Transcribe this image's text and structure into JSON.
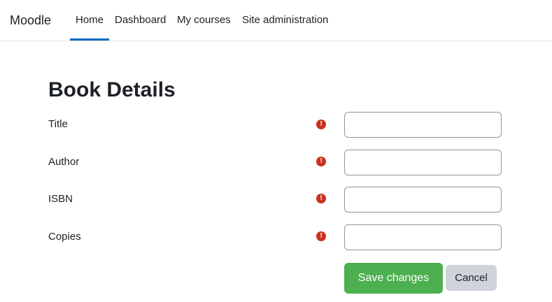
{
  "navbar": {
    "brand": "Moodle",
    "items": [
      {
        "label": "Home",
        "active": true
      },
      {
        "label": "Dashboard",
        "active": false
      },
      {
        "label": "My courses",
        "active": false
      },
      {
        "label": "Site administration",
        "active": false
      }
    ],
    "active_color": "#0f6cbf"
  },
  "main": {
    "title": "Book Details",
    "fields": [
      {
        "label": "Title",
        "value": "",
        "required": true
      },
      {
        "label": "Author",
        "value": "",
        "required": true
      },
      {
        "label": "ISBN",
        "value": "",
        "required": true
      },
      {
        "label": "Copies",
        "value": "",
        "required": true
      }
    ],
    "required_icon": "exclamation-circle-icon",
    "required_glyph": "!",
    "required_color": "#ca3120"
  },
  "actions": {
    "save_label": "Save changes",
    "save_color": "#4caf50",
    "cancel_label": "Cancel",
    "cancel_color": "#ced4da"
  }
}
